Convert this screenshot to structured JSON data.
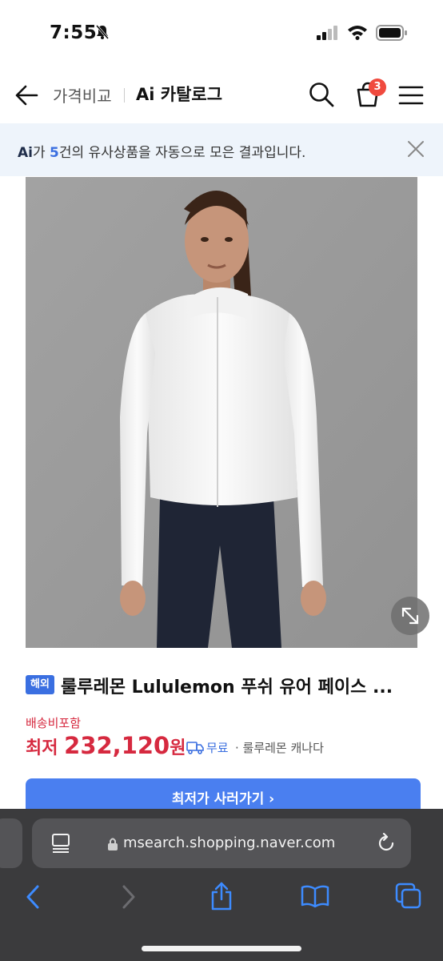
{
  "status_bar": {
    "time": "7:55"
  },
  "header": {
    "breadcrumb_price": "가격비교",
    "title": "Ai 카탈로그",
    "cart_count": "3"
  },
  "banner": {
    "ai_label": "Ai",
    "text_1": "가 ",
    "count": "5",
    "text_2": "건의 유사상품을 자동으로 모은 결과입니다."
  },
  "product": {
    "badge": "해외",
    "title": "룰루레몬 Lululemon 푸쉬 유어 페이스 ...",
    "shipping_included": "배송비포함",
    "price_prefix": "최저 ",
    "price": "232,120",
    "price_unit": "원",
    "shipping": "무료",
    "seller": "· 룰루레몬 캐나다",
    "buy_label": "최저가 사러가기 ›"
  },
  "browser": {
    "url": "msearch.shopping.naver.com"
  },
  "colors": {
    "price_red": "#d6293f",
    "accent_blue": "#4a7ff0",
    "badge_blue": "#3a6fe1",
    "cart_badge": "#f04a3e"
  }
}
